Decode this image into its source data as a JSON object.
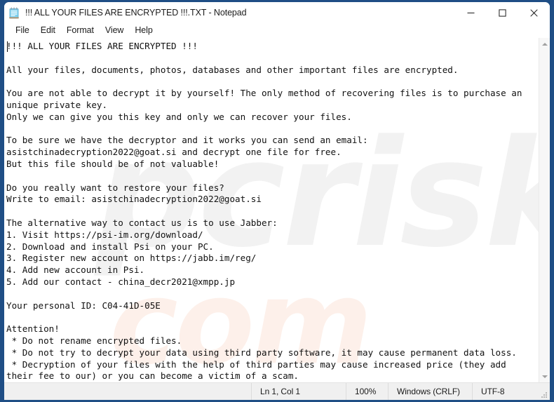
{
  "window": {
    "title": "!!! ALL YOUR FILES ARE ENCRYPTED !!!.TXT - Notepad",
    "app_icon": "notepad-icon",
    "frame_color": "#1f4e85",
    "buttons": {
      "minimize": "minimize-button",
      "maximize": "maximize-button",
      "close": "close-button"
    }
  },
  "menubar": {
    "items": [
      {
        "label": "File"
      },
      {
        "label": "Edit"
      },
      {
        "label": "Format"
      },
      {
        "label": "View"
      },
      {
        "label": "Help"
      }
    ]
  },
  "document": {
    "content": "!!! ALL YOUR FILES ARE ENCRYPTED !!!\n\nAll your files, documents, photos, databases and other important files are encrypted.\n\nYou are not able to decrypt it by yourself! The only method of recovering files is to purchase an\nunique private key.\nOnly we can give you this key and only we can recover your files.\n\nTo be sure we have the decryptor and it works you can send an email:\nasistchinadecryption2022@goat.si and decrypt one file for free.\nBut this file should be of not valuable!\n\nDo you really want to restore your files?\nWrite to email: asistchinadecryption2022@goat.si\n\nThe alternative way to contact us is to use Jabber:\n1. Visit https://psi-im.org/download/\n2. Download and install Psi on your PC.\n3. Register new account on https://jabb.im/reg/\n4. Add new account in Psi.\n5. Add our contact - china_decr2021@xmpp.jp\n\nYour personal ID: C04-41D-05E\n\nAttention!\n * Do not rename encrypted files.\n * Do not try to decrypt your data using third party software, it may cause permanent data loss.\n * Decryption of your files with the help of third parties may cause increased price (they add\ntheir fee to our) or you can become a victim of a scam.",
    "contact_email": "asistchinadecryption2022@goat.si",
    "jabber_contact": "china_decr2021@xmpp.jp",
    "personal_id": "C04-41D-05E",
    "psi_download_url": "https://psi-im.org/download/",
    "jabber_register_url": "https://jabb.im/reg/"
  },
  "watermark": {
    "primary": "pcrisk",
    "secondary": "com",
    "primary_color": "#f2f2f2",
    "secondary_color": "#fdf0ea"
  },
  "scrollbar": {
    "up_arrow": "scroll-up-arrow",
    "down_arrow": "scroll-down-arrow"
  },
  "statusbar": {
    "cursor_position": "Ln 1, Col 1",
    "zoom": "100%",
    "line_ending": "Windows (CRLF)",
    "encoding": "UTF-8"
  }
}
